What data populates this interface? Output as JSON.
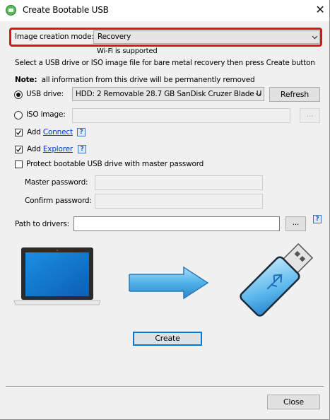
{
  "window": {
    "title": "Create Bootable USB",
    "close_glyph": "✕"
  },
  "image_mode": {
    "label": "Image creation mode:",
    "value": "Recovery",
    "note": "Wi-Fi is supported"
  },
  "instruction": "Select a USB drive or ISO image file for bare metal recovery then press Create button",
  "warning": {
    "bold": "Note:",
    "text": "all information from this drive will be permanently removed"
  },
  "usb": {
    "label": "USB drive:",
    "value": "HDD: 2 Removable 28.7 GB SanDisk Cruzer Blade U",
    "refresh": "Refresh",
    "selected": true
  },
  "iso": {
    "label": "ISO image:",
    "value": "",
    "browse": "..."
  },
  "add_connect": {
    "prefix": "Add",
    "link": "Connect",
    "checked": true,
    "help": "?"
  },
  "add_explorer": {
    "prefix": "Add",
    "link": "Explorer",
    "checked": true,
    "help": "?"
  },
  "protect": {
    "label": "Protect bootable USB drive with master password",
    "checked": false
  },
  "master_password": {
    "label": "Master password:",
    "value": ""
  },
  "confirm_password": {
    "label": "Confirm password:",
    "value": ""
  },
  "drivers": {
    "label": "Path to drivers:",
    "value": "",
    "browse": "...",
    "help": "?"
  },
  "create_button": "Create",
  "close_button": "Close",
  "icons": {
    "app": "usb-app-icon",
    "laptop": "laptop-icon",
    "arrow": "arrow-right-icon",
    "usb_stick": "usb-stick-icon"
  },
  "colors": {
    "highlight": "#e0101a",
    "accent": "#1e7ad8"
  }
}
